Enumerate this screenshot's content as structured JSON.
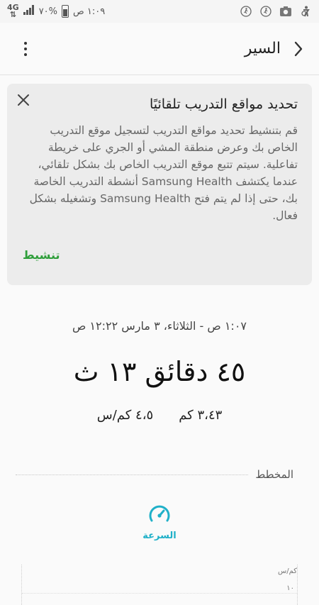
{
  "status_bar": {
    "time": "١:٠٩ ص",
    "battery": "%٧٠",
    "network": "4G",
    "icons": [
      "walking-icon",
      "walking-icon",
      "camera-icon",
      "accessibility-icon"
    ]
  },
  "app_bar": {
    "title": "السير",
    "menu_icon": "more-vert-icon",
    "back_icon": "chevron-right-icon"
  },
  "card": {
    "title": "تحديد مواقع التدريب تلقائيًا",
    "body": "قم بتنشيط تحديد مواقع التدريب لتسجيل موقع التدريب الخاص بك وعرض منطقة المشي أو الجري على خريطة تفاعلية. سيتم تتبع موقع التدريب الخاص بك بشكل تلقائي، عندما يكتشف Samsung Health أنشطة التدريب الخاصة بك، حتى إذا لم يتم فتح Samsung Health وتشغيله بشكل فعال.",
    "action": "تنشيط",
    "close_icon": "close-icon"
  },
  "summary": {
    "datetime": "١:٠٧ ص - الثلاثاء، ٣ مارس ١٢:٢٢ ص",
    "duration": "٤٥ دقائق ١٣ ث",
    "distance": "٣،٤٣ كم",
    "speed": "٤،٥ كم/س"
  },
  "chart_section": {
    "title": "المخطط",
    "tab_label": "السرعة",
    "tab_icon": "speedometer-icon",
    "unit": "كم/س",
    "tick": "١٠"
  },
  "colors": {
    "accent_green": "#2e9e3a",
    "accent_teal": "#1fb0c8",
    "card_bg": "#ececec"
  }
}
